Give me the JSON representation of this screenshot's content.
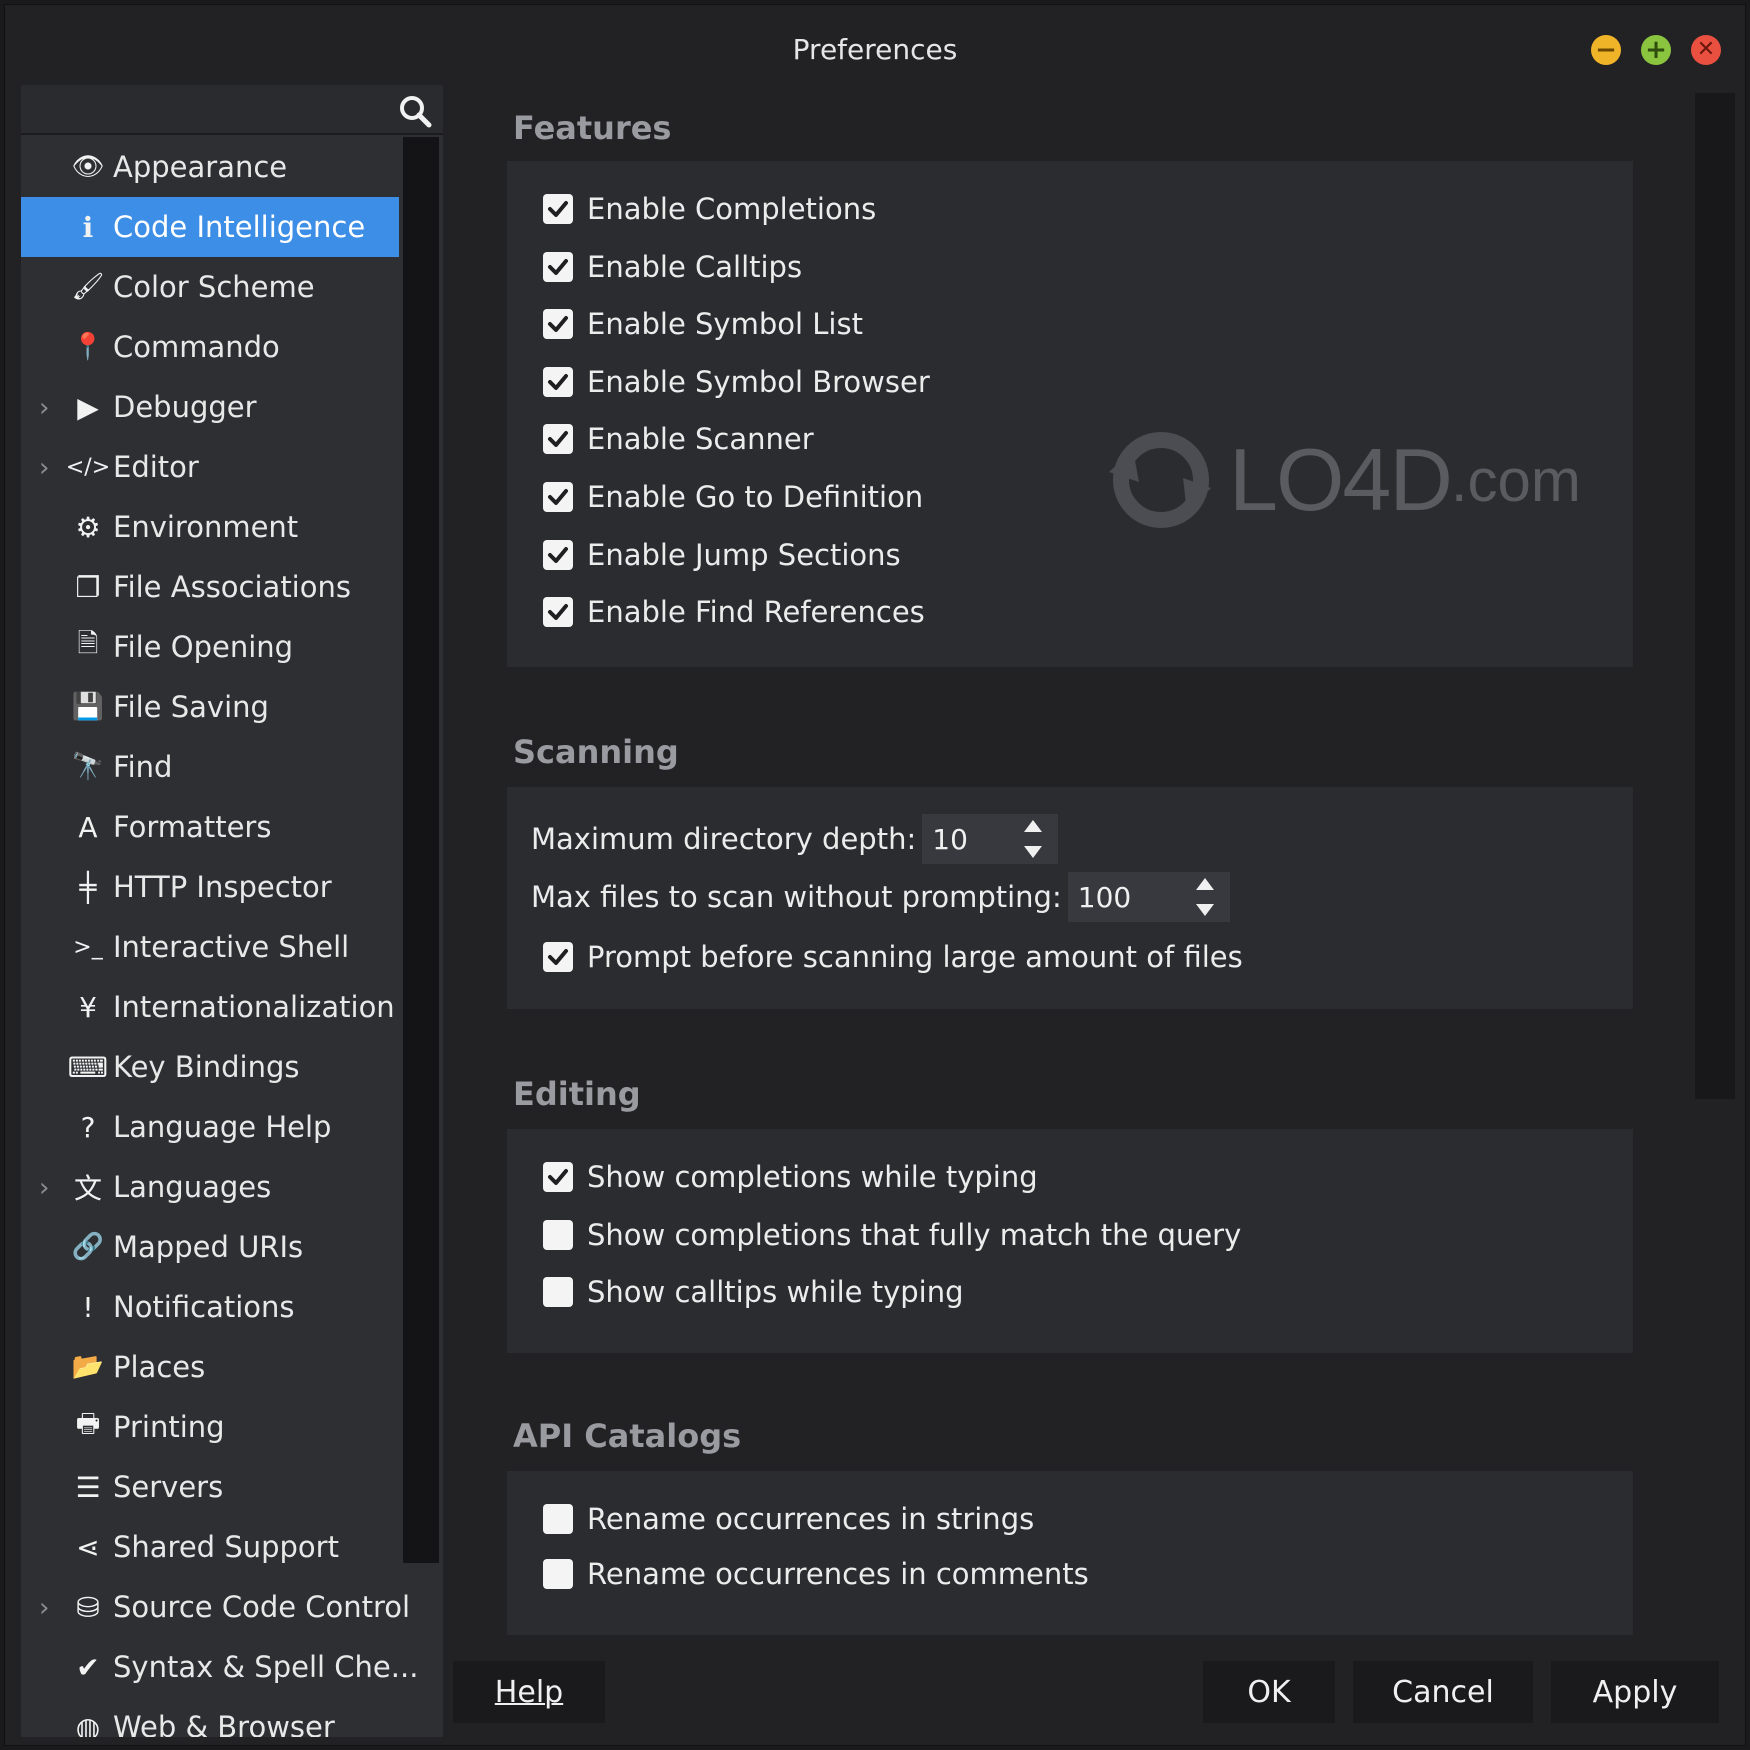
{
  "window": {
    "title": "Preferences"
  },
  "search": {
    "placeholder": ""
  },
  "sidebar": {
    "items": [
      {
        "label": "Appearance",
        "icon": "eye-icon",
        "glyph": "👁",
        "expandable": false,
        "selected": false
      },
      {
        "label": "Code Intelligence",
        "icon": "info-icon",
        "glyph": "ℹ",
        "expandable": false,
        "selected": true
      },
      {
        "label": "Color Scheme",
        "icon": "brush-icon",
        "glyph": "🖌",
        "expandable": false,
        "selected": false
      },
      {
        "label": "Commando",
        "icon": "pin-icon",
        "glyph": "📍",
        "expandable": false,
        "selected": false
      },
      {
        "label": "Debugger",
        "icon": "play-icon",
        "glyph": "▶",
        "expandable": true,
        "selected": false
      },
      {
        "label": "Editor",
        "icon": "code-icon",
        "glyph": "</>",
        "expandable": true,
        "selected": false
      },
      {
        "label": "Environment",
        "icon": "gear-icon",
        "glyph": "⚙",
        "expandable": false,
        "selected": false
      },
      {
        "label": "File Associations",
        "icon": "copy-icon",
        "glyph": "❐",
        "expandable": false,
        "selected": false
      },
      {
        "label": "File Opening",
        "icon": "file-icon",
        "glyph": "🗎",
        "expandable": false,
        "selected": false
      },
      {
        "label": "File Saving",
        "icon": "save-icon",
        "glyph": "💾",
        "expandable": false,
        "selected": false
      },
      {
        "label": "Find",
        "icon": "binoculars-icon",
        "glyph": "🔭",
        "expandable": false,
        "selected": false
      },
      {
        "label": "Formatters",
        "icon": "font-icon",
        "glyph": "A",
        "expandable": false,
        "selected": false
      },
      {
        "label": "HTTP Inspector",
        "icon": "signpost-icon",
        "glyph": "╪",
        "expandable": false,
        "selected": false
      },
      {
        "label": "Interactive Shell",
        "icon": "terminal-icon",
        "glyph": ">_",
        "expandable": false,
        "selected": false
      },
      {
        "label": "Internationalization",
        "icon": "yen-icon",
        "glyph": "¥",
        "expandable": false,
        "selected": false
      },
      {
        "label": "Key Bindings",
        "icon": "keyboard-icon",
        "glyph": "⌨",
        "expandable": false,
        "selected": false
      },
      {
        "label": "Language Help",
        "icon": "question-icon",
        "glyph": "?",
        "expandable": false,
        "selected": false
      },
      {
        "label": "Languages",
        "icon": "translate-icon",
        "glyph": "文",
        "expandable": true,
        "selected": false
      },
      {
        "label": "Mapped URIs",
        "icon": "link-icon",
        "glyph": "🔗",
        "expandable": false,
        "selected": false
      },
      {
        "label": "Notifications",
        "icon": "alert-icon",
        "glyph": "!",
        "expandable": false,
        "selected": false
      },
      {
        "label": "Places",
        "icon": "folder-icon",
        "glyph": "📂",
        "expandable": false,
        "selected": false
      },
      {
        "label": "Printing",
        "icon": "printer-icon",
        "glyph": "🖶",
        "expandable": false,
        "selected": false
      },
      {
        "label": "Servers",
        "icon": "server-icon",
        "glyph": "☰",
        "expandable": false,
        "selected": false
      },
      {
        "label": "Shared Support",
        "icon": "share-icon",
        "glyph": "⋖",
        "expandable": false,
        "selected": false
      },
      {
        "label": "Source Code Control",
        "icon": "database-icon",
        "glyph": "⛁",
        "expandable": true,
        "selected": false
      },
      {
        "label": "Syntax & Spell Che...",
        "icon": "check-circle-icon",
        "glyph": "✔",
        "expandable": false,
        "selected": false
      },
      {
        "label": "Web & Browser",
        "icon": "globe-icon",
        "glyph": "◍",
        "expandable": false,
        "selected": false
      }
    ]
  },
  "features": {
    "title": "Features",
    "options": [
      {
        "label": "Enable Completions",
        "checked": true
      },
      {
        "label": "Enable Calltips",
        "checked": true
      },
      {
        "label": "Enable Symbol List",
        "checked": true
      },
      {
        "label": "Enable Symbol Browser",
        "checked": true
      },
      {
        "label": "Enable Scanner",
        "checked": true
      },
      {
        "label": "Enable Go to Definition",
        "checked": true
      },
      {
        "label": "Enable Jump Sections",
        "checked": true
      },
      {
        "label": "Enable Find References",
        "checked": true
      }
    ]
  },
  "scanning": {
    "title": "Scanning",
    "max_depth_label": "Maximum directory depth:",
    "max_depth_value": "10",
    "max_files_label": "Max files to scan without prompting:",
    "max_files_value": "100",
    "prompt_label": "Prompt before scanning large amount of files",
    "prompt_checked": true
  },
  "editing": {
    "title": "Editing",
    "options": [
      {
        "label": "Show completions while typing",
        "checked": true
      },
      {
        "label": "Show completions that fully match the query",
        "checked": false
      },
      {
        "label": "Show calltips while typing",
        "checked": false
      }
    ]
  },
  "api_catalogs": {
    "title": "API Catalogs",
    "options": [
      {
        "label": "Rename occurrences in strings",
        "checked": false
      },
      {
        "label": "Rename occurrences in comments",
        "checked": false
      }
    ]
  },
  "buttons": {
    "help": "Help",
    "ok": "OK",
    "cancel": "Cancel",
    "apply": "Apply"
  },
  "watermark": {
    "brand": "LO4D",
    "suffix": ".com"
  },
  "colors": {
    "selection": "#3d8ee6",
    "background": "#222225",
    "panel": "#2b2c30"
  }
}
